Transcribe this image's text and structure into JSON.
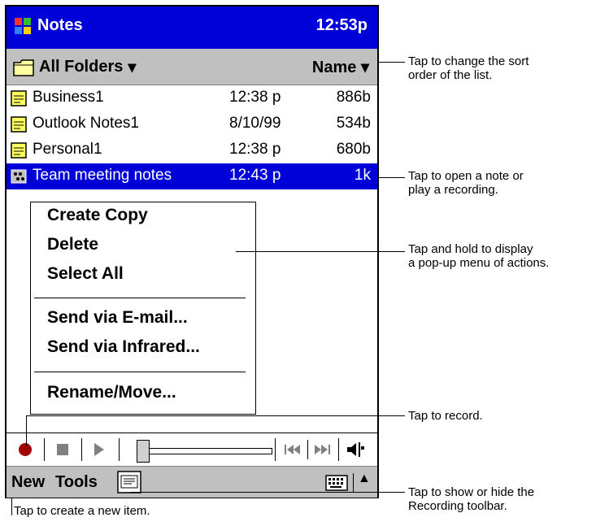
{
  "titlebar": {
    "app_title": "Notes",
    "clock": "12:53p"
  },
  "folderbar": {
    "folder": "All Folders",
    "sort": "Name"
  },
  "notes": [
    {
      "name": "Business1",
      "date": "12:38 p",
      "size": "886b"
    },
    {
      "name": "Outlook Notes1",
      "date": "8/10/99",
      "size": "534b"
    },
    {
      "name": "Personal1",
      "date": "12:38 p",
      "size": "680b"
    },
    {
      "name": "Team meeting notes",
      "date": "12:43 p",
      "size": "1k"
    }
  ],
  "menu": {
    "create_copy": "Create Copy",
    "delete": "Delete",
    "select_all": "Select All",
    "send_email": "Send via E-mail...",
    "send_infrared": "Send via Infrared...",
    "rename_move": "Rename/Move..."
  },
  "cmdbar": {
    "new": "New",
    "tools": "Tools"
  },
  "annotations": {
    "sort": "Tap to change the sort\norder of the list.",
    "open": "Tap to open a note or\nplay a recording.",
    "popup": "Tap and hold to display\na pop-up menu of actions.",
    "record": "Tap to record.",
    "toolbar": "Tap to show or hide the\nRecording toolbar.",
    "new_item": "Tap to create a new item."
  },
  "colors": {
    "titlebar": "#0000d8",
    "selection": "#0000d8",
    "bars": "#c0c0c0",
    "record": "#a00000"
  }
}
